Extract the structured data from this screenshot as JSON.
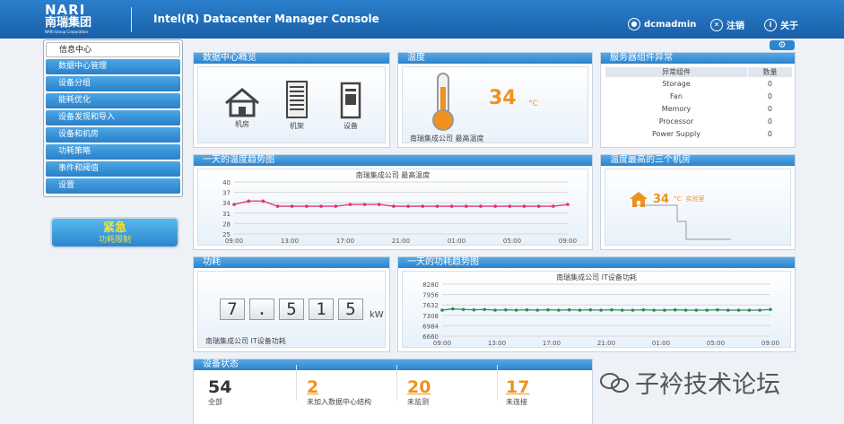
{
  "header": {
    "logo_text": "NARI",
    "logo_cn": "南瑞集团",
    "logo_en": "NARI Group Corporation",
    "title": "Intel(R) Datacenter Manager Console",
    "user": "dcmadmin",
    "logout": "注销",
    "about": "关于"
  },
  "sidebar": {
    "items": [
      {
        "label": "信息中心"
      },
      {
        "label": "数据中心管理"
      },
      {
        "label": "设备分组"
      },
      {
        "label": "能耗优化"
      },
      {
        "label": "设备发现和导入"
      },
      {
        "label": "设备和机房"
      },
      {
        "label": "功耗策略"
      },
      {
        "label": "事件和阈值"
      },
      {
        "label": "设置"
      }
    ],
    "emergency_title": "紧急",
    "emergency_sub": "功耗限制"
  },
  "overview": {
    "title": "数据中心概览",
    "items": [
      {
        "label": "机房",
        "icon": "house-icon"
      },
      {
        "label": "机架",
        "icon": "rack-icon"
      },
      {
        "label": "设备",
        "icon": "server-icon"
      }
    ]
  },
  "temperature": {
    "title": "温度",
    "value": "34",
    "unit": "°C",
    "caption": "南瑞集成公司 最高温度"
  },
  "components": {
    "title": "服务器组件异常",
    "headers": [
      "异常组件",
      "数量"
    ],
    "rows": [
      {
        "name": "Storage",
        "count": "0"
      },
      {
        "name": "Fan",
        "count": "0"
      },
      {
        "name": "Memory",
        "count": "0"
      },
      {
        "name": "Processor",
        "count": "0"
      },
      {
        "name": "Power Supply",
        "count": "0"
      }
    ]
  },
  "temp_trend": {
    "title": "一天的温度趋势图",
    "chart_title": "南瑞集成公司 最高温度"
  },
  "hot_rooms": {
    "title": "温度最高的三个机房",
    "value": "34",
    "unit": "°C",
    "room": "实验室"
  },
  "power": {
    "title": "功耗",
    "digits": [
      "7",
      ".",
      "5",
      "1",
      "5"
    ],
    "unit": "kW",
    "caption": "南瑞集成公司 IT设备功耗"
  },
  "power_trend": {
    "title": "一天的功耗趋势图",
    "chart_title": "南瑞集成公司 IT设备功耗"
  },
  "device_status": {
    "title": "设备状态",
    "items": [
      {
        "num": "54",
        "label": "全部"
      },
      {
        "num": "2",
        "label": "未加入数据中心结构"
      },
      {
        "num": "20",
        "label": "未监测"
      },
      {
        "num": "17",
        "label": "未连接"
      }
    ]
  },
  "watermark": "子衿技术论坛",
  "colors": {
    "accent": "#2a80c8",
    "orange": "#f0921e",
    "temp_line": "#e0307a",
    "power_line": "#2e8b57"
  },
  "chart_data": [
    {
      "type": "line",
      "title": "南瑞集成公司 最高温度",
      "x_ticks": [
        "09:00",
        "13:00",
        "17:00",
        "21:00",
        "01:00",
        "05:00",
        "09:00"
      ],
      "y_ticks": [
        25,
        28,
        31,
        34,
        37,
        40
      ],
      "ylim": [
        25,
        40
      ],
      "series": [
        {
          "values": [
            33.5,
            34.5,
            34.5,
            33,
            33,
            33,
            33,
            33,
            33.5,
            33.5,
            33.5,
            33,
            33,
            33,
            33,
            33,
            33,
            33,
            33,
            33,
            33,
            33,
            33,
            33.5
          ]
        }
      ]
    },
    {
      "type": "line",
      "title": "南瑞集成公司 IT设备功耗",
      "x_ticks": [
        "09:00",
        "13:00",
        "17:00",
        "21:00",
        "01:00",
        "05:00",
        "09:00"
      ],
      "y_ticks": [
        6660,
        6984,
        7308,
        7632,
        7956,
        8280
      ],
      "ylim": [
        6660,
        8280
      ],
      "series": [
        {
          "values": [
            7470,
            7510,
            7490,
            7480,
            7490,
            7470,
            7480,
            7470,
            7480,
            7470,
            7480,
            7470,
            7480,
            7470,
            7480,
            7470,
            7480,
            7470,
            7470,
            7480,
            7470,
            7470,
            7480,
            7470,
            7470,
            7470,
            7480,
            7470,
            7470,
            7470,
            7470,
            7490
          ]
        }
      ]
    }
  ]
}
